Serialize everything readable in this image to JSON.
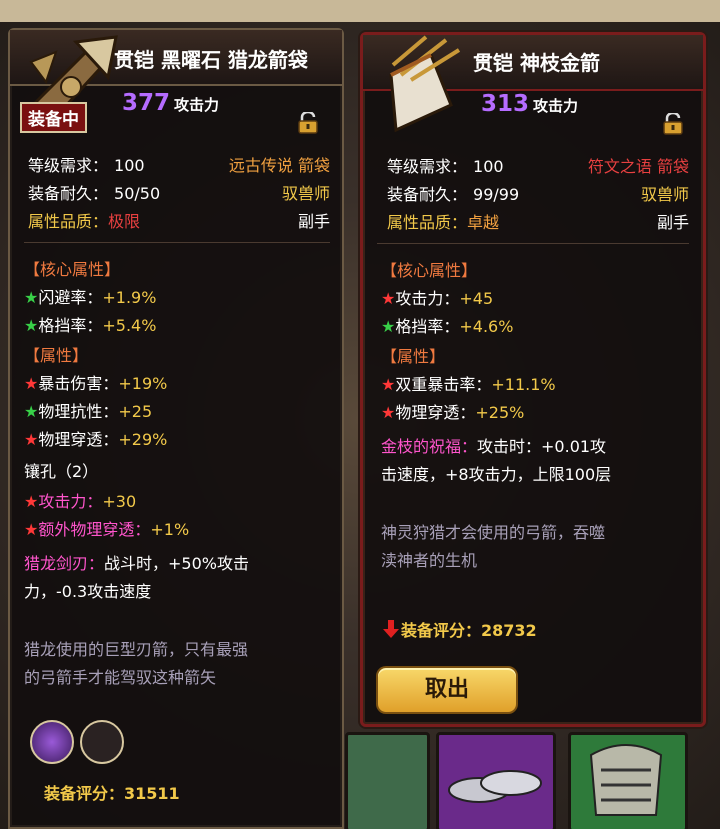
{
  "left": {
    "title": "贯铠 黑曜石 猎龙箭袋",
    "badge": "装备中",
    "attack_value": "377",
    "attack_label": "攻击力",
    "req_label": "等级需求：",
    "req_value": "100",
    "rarity_label": "远古传说 箭袋",
    "dur_label": "装备耐久：",
    "dur_value": "50/50",
    "class_label": "驭兽师",
    "quality_label": "属性品质：",
    "quality_value": "极限",
    "slot_label": "副手",
    "core_header": "【核心属性】",
    "core": [
      {
        "star": "green",
        "name": "闪避率：",
        "value": "+1.9%"
      },
      {
        "star": "green",
        "name": "格挡率：",
        "value": "+5.4%"
      }
    ],
    "attr_header": "【属性】",
    "attrs": [
      {
        "star": "red",
        "name": "暴击伤害：",
        "value": "+19%"
      },
      {
        "star": "green",
        "name": "物理抗性：",
        "value": "+25"
      },
      {
        "star": "red",
        "name": "物理穿透：",
        "value": "+29%"
      }
    ],
    "socket_header": "镶孔（2）",
    "sockets": [
      {
        "star": "red",
        "name": "攻击力：",
        "value": "+30"
      },
      {
        "star": "red",
        "name": "额外物理穿透：",
        "value": "+1%"
      }
    ],
    "skill_name": "猎龙剑刃：",
    "skill_line1": "战斗时，+50%攻击",
    "skill_line2": "力，-0.3攻击速度",
    "lore_line1": "猎龙使用的巨型刃箭，只有最强",
    "lore_line2": "的弓箭手才能驾驭这种箭矢",
    "score_label": "装备评分：",
    "score_value": "31511"
  },
  "right": {
    "title": "贯铠 神枝金箭",
    "attack_value": "313",
    "attack_label": "攻击力",
    "req_label": "等级需求：",
    "req_value": "100",
    "rarity_label": "符文之语 箭袋",
    "dur_label": "装备耐久：",
    "dur_value": "99/99",
    "class_label": "驭兽师",
    "quality_label": "属性品质：",
    "quality_value": "卓越",
    "slot_label": "副手",
    "core_header": "【核心属性】",
    "core": [
      {
        "star": "red",
        "name": "攻击力：",
        "value": "+45"
      },
      {
        "star": "green",
        "name": "格挡率：",
        "value": "+4.6%"
      }
    ],
    "attr_header": "【属性】",
    "attrs": [
      {
        "star": "red",
        "name": "双重暴击率：",
        "value": "+11.1%"
      },
      {
        "star": "red",
        "name": "物理穿透：",
        "value": "+25%"
      }
    ],
    "blessing_name": "金枝的祝福：",
    "blessing_line1": "攻击时：+0.01攻",
    "blessing_line2": "击速度，+8攻击力，上限100层",
    "lore_line1": "神灵狩猎才会使用的弓箭，吞噬",
    "lore_line2": "渎神者的生机",
    "score_label": "装备评分：",
    "score_value": "28732",
    "take_out_button": "取出"
  },
  "icons": {
    "star": "★",
    "lock": "lock-icon",
    "arrow_down": "red-down-arrow-icon"
  },
  "colors": {
    "attack_purple": "#b56cff",
    "value_yellow": "#f2c94a",
    "rarity_orange": "#f0a040",
    "extreme_red": "#e84040",
    "skill_pink": "#ff55cc",
    "lore_gray": "#a8a0b8"
  }
}
